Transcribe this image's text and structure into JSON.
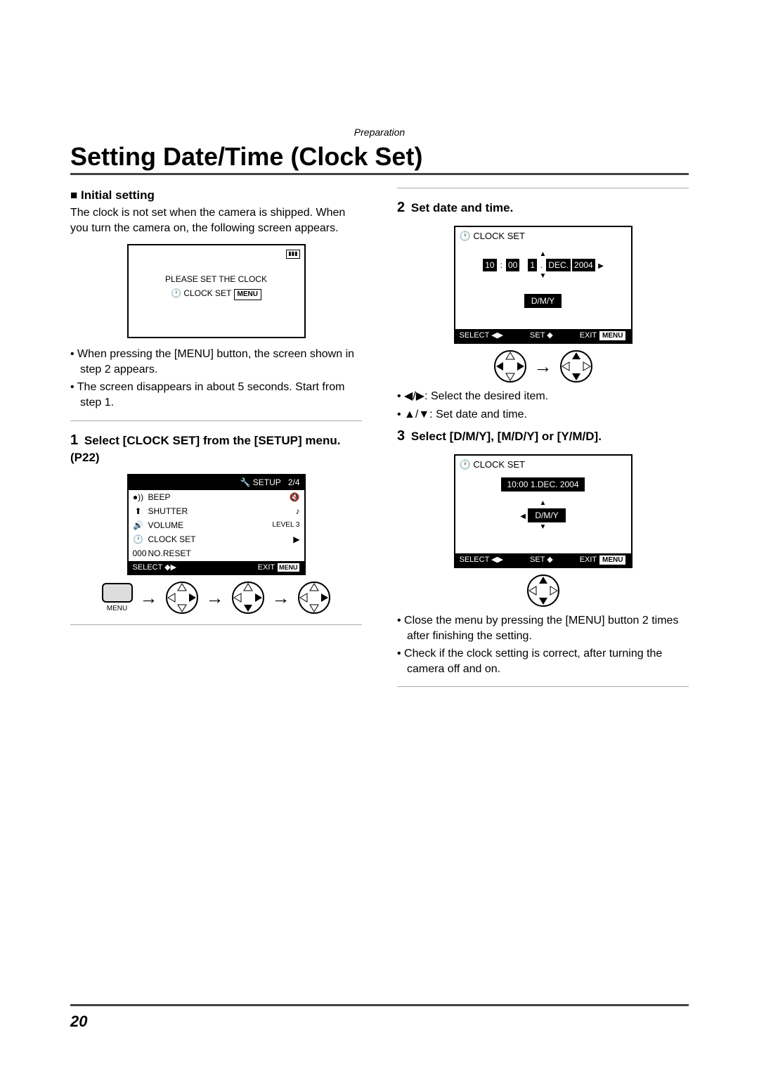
{
  "section_label": "Preparation",
  "title": "Setting Date/Time (Clock Set)",
  "page_number": "20",
  "left": {
    "subheading": "Initial setting",
    "intro": "The clock is not set when the camera is shipped. When you turn the camera on, the following screen appears.",
    "screen1": {
      "line1": "PLEASE SET THE CLOCK",
      "line2_prefix": "CLOCK SET",
      "menu": "MENU"
    },
    "bullets": [
      "When pressing the [MENU] button, the screen shown in step 2 appears.",
      "The screen disappears in about 5 seconds. Start from step 1."
    ],
    "step1_num": "1",
    "step1_text": "Select [CLOCK SET] from the [SETUP] menu. (P22)",
    "setup": {
      "header_left": "SETUP",
      "header_right": "2/4",
      "r1": "BEEP",
      "r2": "SHUTTER",
      "r3": "VOLUME",
      "r3_val": "LEVEL 3",
      "r4": "CLOCK SET",
      "r5": "NO.RESET",
      "f_left": "SELECT",
      "f_right": "EXIT",
      "f_menu": "MENU"
    },
    "menu_label": "MENU"
  },
  "right": {
    "step2_num": "2",
    "step2_text": "Set date and time.",
    "cs1": {
      "title": "CLOCK SET",
      "hh": "10",
      "mm": "00",
      "d": "1",
      "mon": "DEC.",
      "yy": "2004",
      "fmt": "D/M/Y",
      "f_select": "SELECT",
      "f_set": "SET",
      "f_exit": "EXIT",
      "f_menu": "MENU"
    },
    "cs1_b1": ": Select the desired item.",
    "cs1_b2": ": Set date and time.",
    "step3_num": "3",
    "step3_text": "Select [D/M/Y], [M/D/Y] or [Y/M/D].",
    "cs2": {
      "title": "CLOCK SET",
      "line": "10:00  1.DEC. 2004",
      "fmt": "D/M/Y",
      "f_select": "SELECT",
      "f_set": "SET",
      "f_exit": "EXIT",
      "f_menu": "MENU"
    },
    "bullets": [
      "Close the menu by pressing the [MENU] button 2 times after finishing the setting.",
      "Check if the clock setting is correct, after turning the camera off and on."
    ]
  }
}
